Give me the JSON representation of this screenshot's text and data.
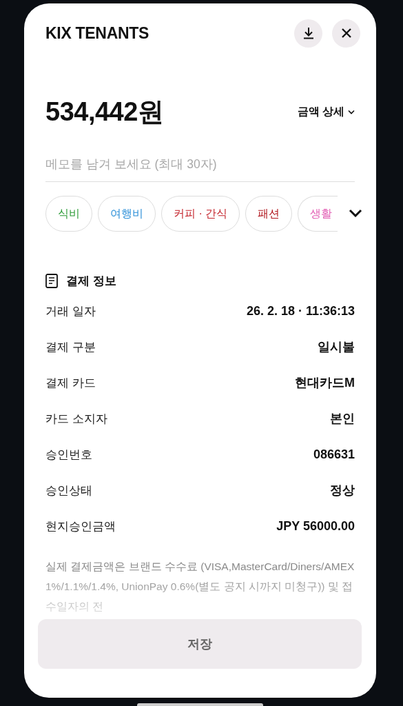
{
  "header": {
    "title": "KIX TENANTS"
  },
  "amount": {
    "value": "534,442원",
    "detail_link": "금액 상세"
  },
  "memo": {
    "placeholder": "메모를 남겨 보세요 (최대 30자)"
  },
  "categories": [
    {
      "label": "식비",
      "color": "#2a9a35"
    },
    {
      "label": "여행비",
      "color": "#2b8fd8"
    },
    {
      "label": "커피 · 간식",
      "color": "#c4232b"
    },
    {
      "label": "패션",
      "color": "#b0141b"
    },
    {
      "label": "생활",
      "color": "#e25fb4"
    }
  ],
  "payment_info": {
    "title": "결제 정보",
    "rows": [
      {
        "label": "거래 일자",
        "value": "26. 2. 18 · 11:36:13"
      },
      {
        "label": "결제 구분",
        "value": "일시불"
      },
      {
        "label": "결제 카드",
        "value": "현대카드M"
      },
      {
        "label": "카드 소지자",
        "value": "본인"
      },
      {
        "label": "승인번호",
        "value": "086631"
      },
      {
        "label": "승인상태",
        "value": "정상"
      },
      {
        "label": "현지승인금액",
        "value": "JPY 56000.00"
      }
    ]
  },
  "notice": "실제 결제금액은 브랜드 수수료 (VISA,MasterCard/Diners/AMEX 1%/1.1%/1.4%, UnionPay 0.6%(별도 공지 시까지 미청구)) 및 접수일자의 전",
  "save_button": "저장"
}
